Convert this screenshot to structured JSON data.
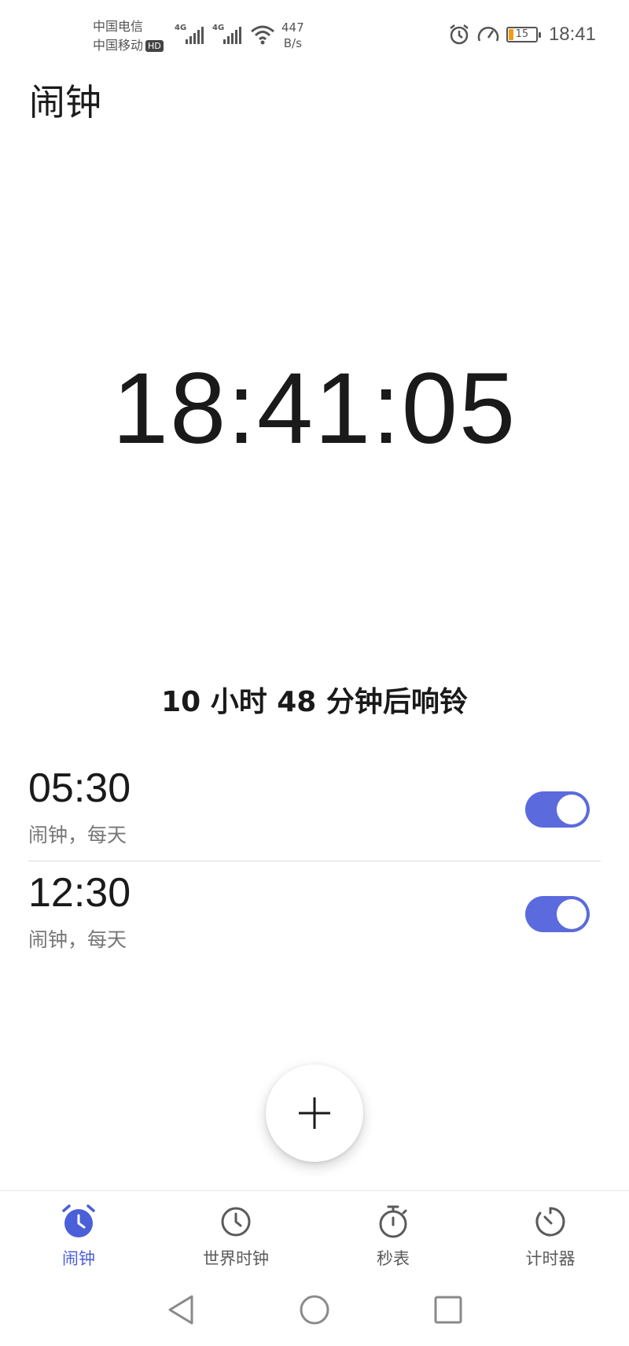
{
  "status_bar": {
    "carrier_1": "中国电信",
    "carrier_2": "中国移动",
    "hd_badge": "HD",
    "network_tag_1": "4G",
    "network_tag_2": "4G",
    "net_speed_value": "447",
    "net_speed_unit": "B/s",
    "battery_percent": "15",
    "time": "18:41"
  },
  "header": {
    "title": "闹钟"
  },
  "clock": {
    "time": "18:41:05"
  },
  "next_alarm_text": "10 小时 48 分钟后响铃",
  "alarms": [
    {
      "time": "05:30",
      "label": "闹钟，每天",
      "enabled": true
    },
    {
      "time": "12:30",
      "label": "闹钟，每天",
      "enabled": true
    }
  ],
  "add_button": {
    "icon": "plus-icon"
  },
  "tabs": [
    {
      "label": "闹钟",
      "icon": "alarm-clock-icon",
      "active": true
    },
    {
      "label": "世界时钟",
      "icon": "world-clock-icon",
      "active": false
    },
    {
      "label": "秒表",
      "icon": "stopwatch-icon",
      "active": false
    },
    {
      "label": "计时器",
      "icon": "timer-icon",
      "active": false
    }
  ],
  "colors": {
    "accent": "#5b6bdd",
    "tab_active": "#4a5fd8",
    "tab_inactive": "#5a5a5a"
  }
}
